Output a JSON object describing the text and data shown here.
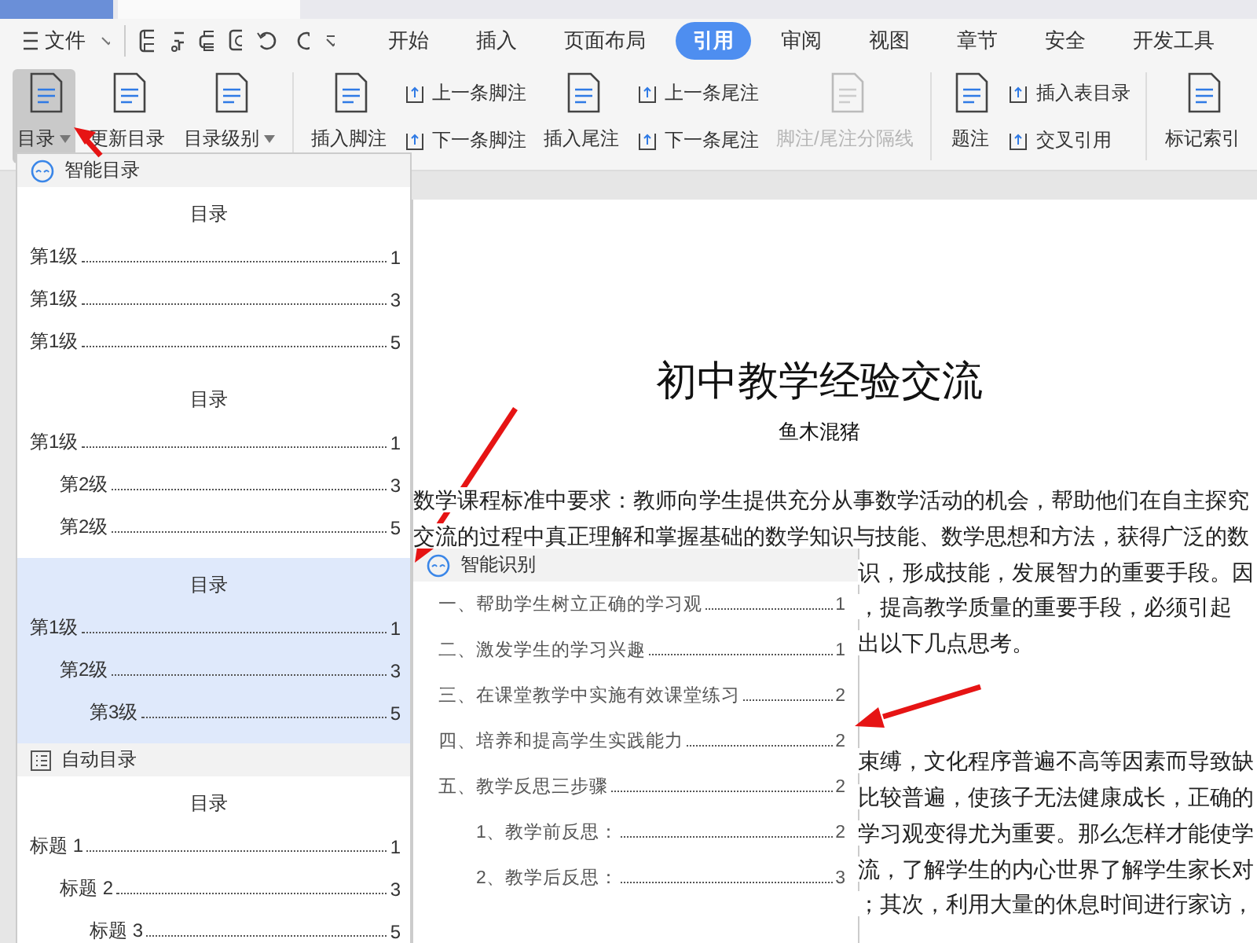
{
  "menu": {
    "file_label": "文件",
    "tabs": [
      {
        "label": "开始",
        "selected": false
      },
      {
        "label": "插入",
        "selected": false
      },
      {
        "label": "页面布局",
        "selected": false
      },
      {
        "label": "引用",
        "selected": true
      },
      {
        "label": "审阅",
        "selected": false
      },
      {
        "label": "视图",
        "selected": false
      },
      {
        "label": "章节",
        "selected": false
      },
      {
        "label": "安全",
        "selected": false
      },
      {
        "label": "开发工具",
        "selected": false
      }
    ]
  },
  "ribbon": {
    "groups": [
      {
        "items": [
          {
            "kind": "large",
            "label": "目录",
            "dropdown": true,
            "pressed": true,
            "disabled": false
          },
          {
            "kind": "large",
            "label": "更新目录",
            "dropdown": false,
            "pressed": false,
            "disabled": false
          },
          {
            "kind": "large",
            "label": "目录级别",
            "dropdown": true,
            "pressed": false,
            "disabled": false
          }
        ]
      },
      {
        "items": [
          {
            "kind": "large",
            "label": "插入脚注",
            "dropdown": false,
            "pressed": false,
            "disabled": false
          },
          {
            "kind": "stack",
            "items": [
              "上一条脚注",
              "下一条脚注"
            ]
          },
          {
            "kind": "large",
            "label": "插入尾注",
            "dropdown": false,
            "pressed": false,
            "disabled": false
          },
          {
            "kind": "stack",
            "items": [
              "上一条尾注",
              "下一条尾注"
            ]
          },
          {
            "kind": "large",
            "label": "脚注/尾注分隔线",
            "dropdown": false,
            "pressed": false,
            "disabled": true
          }
        ]
      },
      {
        "items": [
          {
            "kind": "large",
            "label": "题注",
            "dropdown": false,
            "pressed": false,
            "disabled": false
          },
          {
            "kind": "stack",
            "items": [
              "插入表目录",
              "交叉引用"
            ]
          }
        ]
      },
      {
        "items": [
          {
            "kind": "large",
            "label": "标记索引",
            "dropdown": false,
            "pressed": false,
            "disabled": false
          }
        ]
      }
    ]
  },
  "document": {
    "title": "初中教学经验交流",
    "author": "鱼木混猪",
    "paragraphs": [
      {
        "lines": [
          {
            "kind": "full",
            "text": "数学课程标准中要求：教师向学生提供充分从事数学活动的机会，帮助他们在自主探究"
          },
          {
            "kind": "full",
            "text": "交流的过程中真正理解和掌握基础的数学知识与技能、数学思想和方法，获得广泛的数"
          },
          {
            "kind": "beside-popup",
            "text": "识，形成技能，发展智力的重要手段。因"
          },
          {
            "kind": "beside-popup",
            "text": "，提高教学质量的重要手段，必须引起"
          },
          {
            "kind": "beside-popup",
            "text": "出以下几点思考。"
          }
        ]
      },
      {
        "lines": [
          {
            "kind": "beside-popup",
            "text": "束缚，文化程序普遍不高等因素而导致缺"
          },
          {
            "kind": "beside-popup",
            "text": "比较普遍，使孩子无法健康成长，正确的"
          },
          {
            "kind": "beside-popup",
            "text": "学习观变得尤为重要。那么怎样才能使学"
          },
          {
            "kind": "beside-popup",
            "text": "流，了解学生的内心世界了解学生家长对"
          },
          {
            "kind": "beside-popup",
            "text": "；其次，利用大量的休息时间进行家访，"
          }
        ]
      }
    ]
  },
  "toc_menu": {
    "sections": [
      {
        "kind": "smart",
        "title": "智能目录",
        "previews": [
          {
            "highlighted": false,
            "heading": "目录",
            "entries": [
              {
                "label": "第1级",
                "page": "1"
              },
              {
                "label": "第1级",
                "page": "3"
              },
              {
                "label": "第1级",
                "page": "5"
              }
            ]
          },
          {
            "highlighted": false,
            "heading": "目录",
            "entries": [
              {
                "label": "第1级",
                "page": "1",
                "children": [
                  {
                    "label": "第2级",
                    "page": "3"
                  },
                  {
                    "label": "第2级",
                    "page": "5"
                  }
                ]
              }
            ]
          },
          {
            "highlighted": true,
            "heading": "目录",
            "entries": [
              {
                "label": "第1级",
                "page": "1",
                "children": [
                  {
                    "label": "第2级",
                    "page": "3",
                    "children": [
                      {
                        "label": "第3级",
                        "page": "5"
                      }
                    ]
                  }
                ]
              }
            ]
          }
        ]
      },
      {
        "kind": "auto",
        "title": "自动目录",
        "previews": [
          {
            "highlighted": false,
            "heading": "目录",
            "entries": [
              {
                "label": "标题 1",
                "page": "1",
                "children": [
                  {
                    "label": "标题 2",
                    "page": "3",
                    "children": [
                      {
                        "label": "标题 3",
                        "page": "5"
                      }
                    ]
                  }
                ]
              }
            ]
          }
        ]
      }
    ]
  },
  "recognition_popup": {
    "title": "智能识别",
    "entries": [
      {
        "label": "一、帮助学生树立正确的学习观",
        "page": "1"
      },
      {
        "label": "二、激发学生的学习兴趣",
        "page": "1"
      },
      {
        "label": "三、在课堂教学中实施有效课堂练习",
        "page": "2"
      },
      {
        "label": "四、培养和提高学生实践能力",
        "page": "2"
      },
      {
        "label": "五、教学反思三步骤",
        "page": "2",
        "children": [
          {
            "label": "1、教学前反思：",
            "page": "2"
          },
          {
            "label": "2、教学后反思：",
            "page": "3"
          }
        ]
      }
    ]
  }
}
